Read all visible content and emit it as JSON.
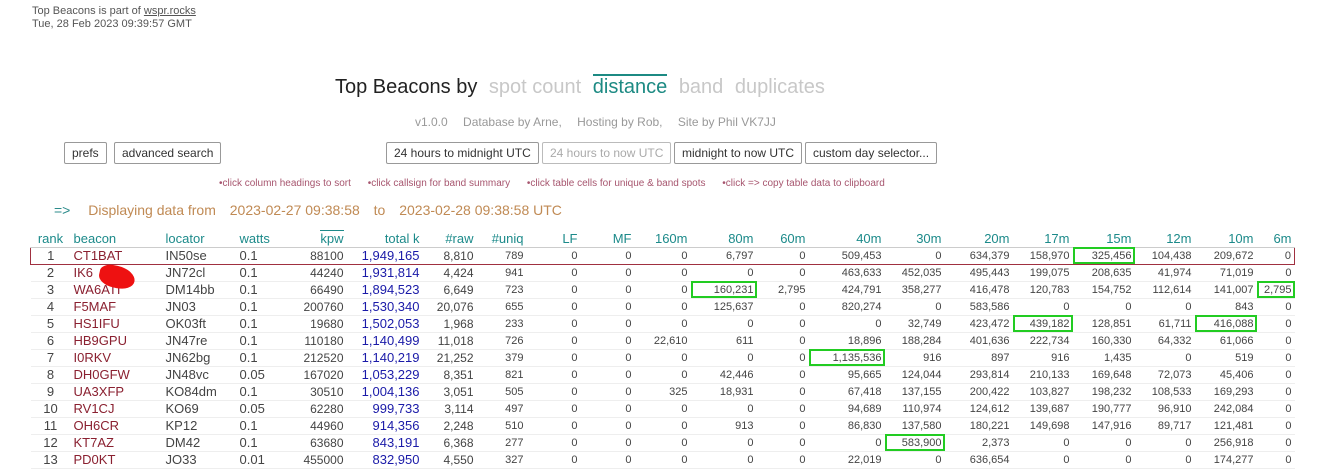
{
  "header": {
    "note_prefix": "Top Beacons is part of ",
    "note_link": "wspr.rocks",
    "timestamp": "Tue, 28 Feb 2023 09:39:57 GMT"
  },
  "title": {
    "prefix": "Top Beacons by",
    "options": [
      "spot count",
      "distance",
      "band",
      "duplicates"
    ],
    "active": "distance"
  },
  "credits": [
    "v1.0.0",
    "Database by Arne,",
    "Hosting by Rob,",
    "Site by Phil VK7JJ"
  ],
  "buttons": {
    "prefs": "prefs",
    "advanced_search": "advanced search",
    "to_midnight": "24 hours to midnight UTC",
    "to_now": "24 hours to now UTC",
    "midnight_to_now": "midnight to now UTC",
    "custom_day": "custom day selector..."
  },
  "hints": [
    "•click column headings to sort",
    "•click callsign for band summary",
    "•click table cells for unique & band spots",
    "•click => copy table data to clipboard"
  ],
  "range": {
    "arrow": "=>",
    "label": "Displaying data from",
    "from": "2023-02-27 09:38:58",
    "to_word": "to",
    "to": "2023-02-28 09:38:58 UTC"
  },
  "table": {
    "headers": [
      "rank",
      "beacon",
      "locator",
      "watts",
      "kpw",
      "total k",
      "#raw",
      "#uniq",
      "LF",
      "MF",
      "160m",
      "80m",
      "60m",
      "40m",
      "30m",
      "20m",
      "17m",
      "15m",
      "12m",
      "10m",
      "6m"
    ],
    "rows": [
      [
        "1",
        "CT1BAT",
        "IN50se",
        "0.1",
        "88100",
        "1,949,165",
        "8,810",
        "789",
        "0",
        "0",
        "0",
        "6,797",
        "0",
        "509,453",
        "0",
        "634,379",
        "158,970",
        "325,456",
        "104,438",
        "209,672",
        "0"
      ],
      [
        "2",
        "IK6",
        "JN72cl",
        "0.1",
        "44240",
        "1,931,814",
        "4,424",
        "941",
        "0",
        "0",
        "0",
        "0",
        "0",
        "463,633",
        "452,035",
        "495,443",
        "199,075",
        "208,635",
        "41,974",
        "71,019",
        "0"
      ],
      [
        "3",
        "WA6ATI",
        "DM14bb",
        "0.1",
        "66490",
        "1,894,523",
        "6,649",
        "723",
        "0",
        "0",
        "0",
        "160,231",
        "2,795",
        "424,791",
        "358,277",
        "416,478",
        "120,783",
        "154,752",
        "112,614",
        "141,007",
        "2,795"
      ],
      [
        "4",
        "F5MAF",
        "JN03",
        "0.1",
        "200760",
        "1,530,340",
        "20,076",
        "655",
        "0",
        "0",
        "0",
        "125,637",
        "0",
        "820,274",
        "0",
        "583,586",
        "0",
        "0",
        "0",
        "843",
        "0"
      ],
      [
        "5",
        "HS1IFU",
        "OK03ft",
        "0.1",
        "19680",
        "1,502,053",
        "1,968",
        "233",
        "0",
        "0",
        "0",
        "0",
        "0",
        "0",
        "32,749",
        "423,472",
        "439,182",
        "128,851",
        "61,711",
        "416,088",
        "0"
      ],
      [
        "6",
        "HB9GPU",
        "JN47re",
        "0.1",
        "110180",
        "1,140,499",
        "11,018",
        "726",
        "0",
        "0",
        "22,610",
        "611",
        "0",
        "18,896",
        "188,284",
        "401,636",
        "222,734",
        "160,330",
        "64,332",
        "61,066",
        "0"
      ],
      [
        "7",
        "I0RKV",
        "JN62bg",
        "0.1",
        "212520",
        "1,140,219",
        "21,252",
        "379",
        "0",
        "0",
        "0",
        "0",
        "0",
        "1,135,536",
        "916",
        "897",
        "916",
        "1,435",
        "0",
        "519",
        "0"
      ],
      [
        "8",
        "DH0GFW",
        "JN48vc",
        "0.05",
        "167020",
        "1,053,229",
        "8,351",
        "821",
        "0",
        "0",
        "0",
        "42,446",
        "0",
        "95,665",
        "124,044",
        "293,814",
        "210,133",
        "169,648",
        "72,073",
        "45,406",
        "0"
      ],
      [
        "9",
        "UA3XFP",
        "KO84dm",
        "0.1",
        "30510",
        "1,004,136",
        "3,051",
        "505",
        "0",
        "0",
        "325",
        "18,931",
        "0",
        "67,418",
        "137,155",
        "200,422",
        "103,827",
        "198,232",
        "108,533",
        "169,293",
        "0"
      ],
      [
        "10",
        "RV1CJ",
        "KO69",
        "0.05",
        "62280",
        "999,733",
        "3,114",
        "497",
        "0",
        "0",
        "0",
        "0",
        "0",
        "94,689",
        "110,974",
        "124,612",
        "139,687",
        "190,777",
        "96,910",
        "242,084",
        "0"
      ],
      [
        "11",
        "OH6CR",
        "KP12",
        "0.1",
        "44960",
        "914,356",
        "2,248",
        "510",
        "0",
        "0",
        "0",
        "913",
        "0",
        "86,830",
        "137,580",
        "180,221",
        "149,698",
        "147,916",
        "89,717",
        "121,481",
        "0"
      ],
      [
        "12",
        "KT7AZ",
        "DM42",
        "0.1",
        "63680",
        "843,191",
        "6,368",
        "277",
        "0",
        "0",
        "0",
        "0",
        "0",
        "0",
        "583,900",
        "2,373",
        "0",
        "0",
        "0",
        "256,918",
        "0"
      ],
      [
        "13",
        "PD0KT",
        "JO33",
        "0.01",
        "455000",
        "832,950",
        "4,550",
        "327",
        "0",
        "0",
        "0",
        "0",
        "0",
        "22,019",
        "0",
        "636,654",
        "0",
        "0",
        "0",
        "174,277",
        "0"
      ]
    ]
  }
}
